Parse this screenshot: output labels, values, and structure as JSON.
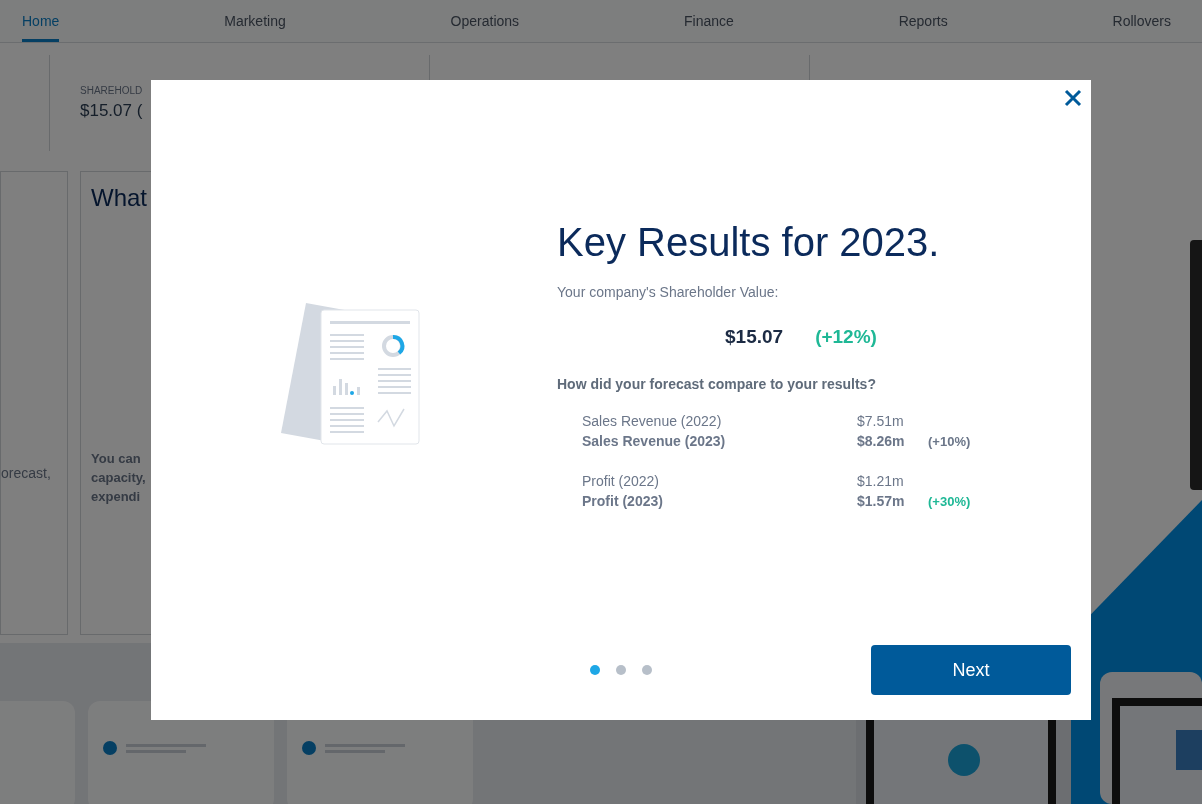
{
  "nav_tabs": [
    {
      "label": "Home",
      "selected": true
    },
    {
      "label": "Marketing",
      "selected": false
    },
    {
      "label": "Operations",
      "selected": false
    },
    {
      "label": "Finance",
      "selected": false
    },
    {
      "label": "Reports",
      "selected": false
    },
    {
      "label": "Rollovers",
      "selected": false
    }
  ],
  "background": {
    "stat_label": "SHAREHOLD",
    "stat_value": "$15.07 (",
    "card_heading": "What",
    "left_card_text": "orecast,",
    "card_text_lines": [
      "You can",
      "capacity,",
      "expendi"
    ]
  },
  "modal": {
    "title": "Key Results for 2023.",
    "subtitle": "Your company's Shareholder Value:",
    "value": "$15.07",
    "change": "(+12%)",
    "question": "How did your forecast compare to your results?",
    "groups": [
      {
        "rows": [
          {
            "label": "Sales Revenue (2022)",
            "value": "$7.51m",
            "emphasis": false
          },
          {
            "label": "Sales Revenue (2023)",
            "value": "$8.26m",
            "change": "(+10%)",
            "color": "#6b7689",
            "emphasis": true
          }
        ]
      },
      {
        "rows": [
          {
            "label": "Profit (2022)",
            "value": "$1.21m",
            "emphasis": false
          },
          {
            "label": "Profit (2023)",
            "value": "$1.57m",
            "change": "(+30%)",
            "color": "#1fb896",
            "emphasis": true
          }
        ]
      }
    ],
    "pager": [
      {
        "selected": true
      },
      {
        "selected": false
      },
      {
        "selected": false
      }
    ],
    "next_button": "Next"
  }
}
